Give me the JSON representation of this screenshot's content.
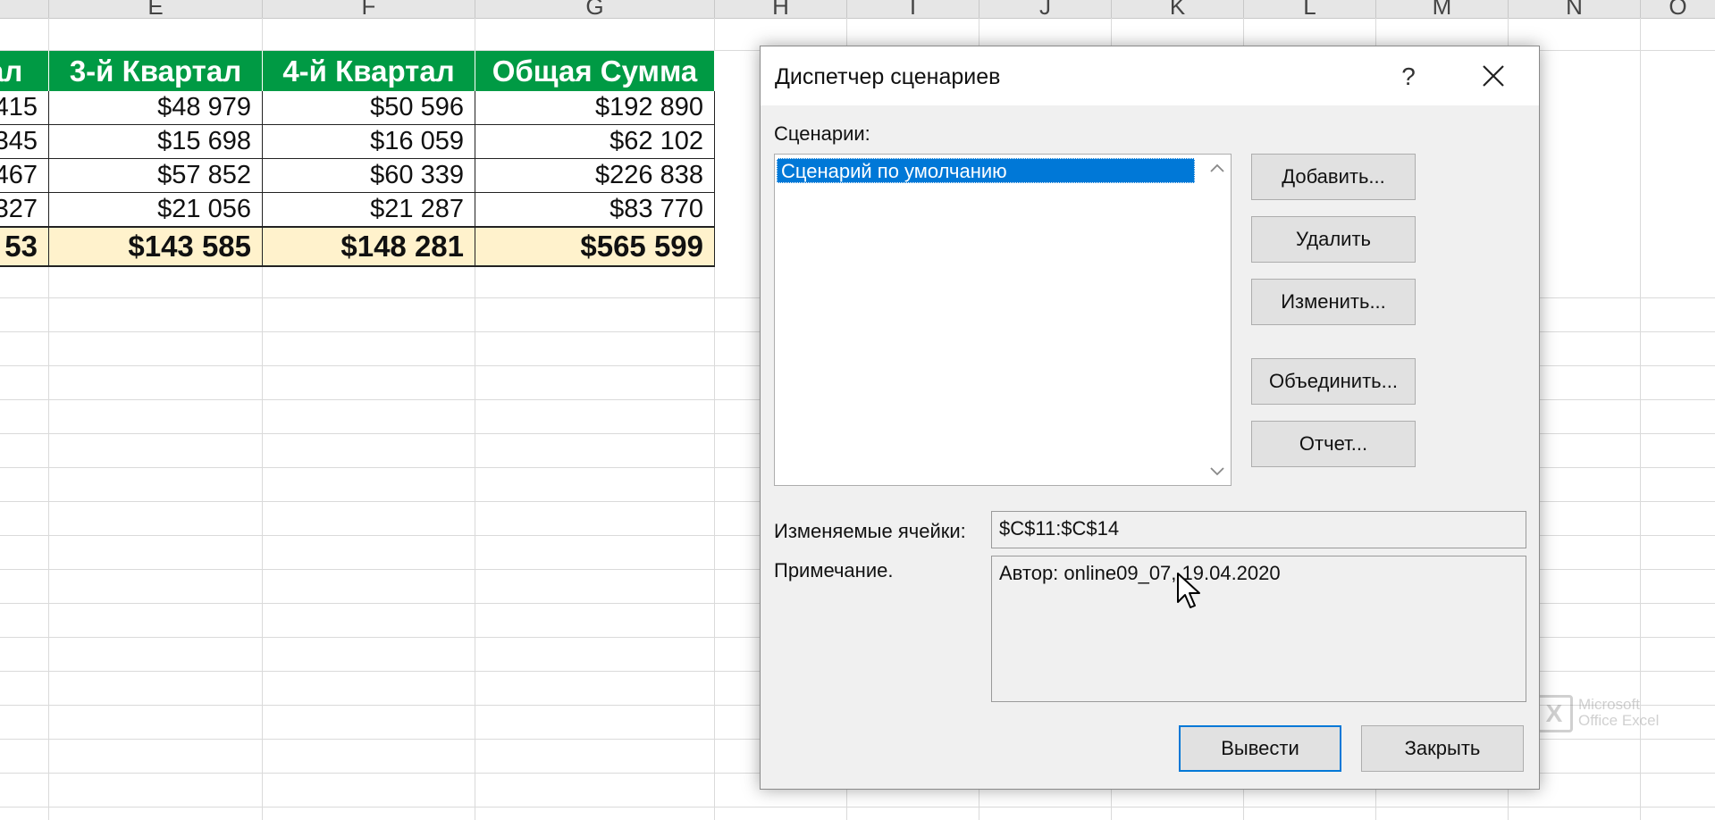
{
  "sheet": {
    "columns": [
      "E",
      "F",
      "G",
      "H",
      "I",
      "J",
      "K",
      "L",
      "M",
      "N",
      "O"
    ],
    "table": {
      "headers": [
        "ал",
        "3-й Квартал",
        "4-й Квартал",
        "Общая Сумма"
      ],
      "rows": [
        [
          "415",
          "$48 979",
          "$50 596",
          "$192 890"
        ],
        [
          "345",
          "$15 698",
          "$16 059",
          "$62 102"
        ],
        [
          "467",
          "$57 852",
          "$60 339",
          "$226 838"
        ],
        [
          "327",
          "$21 056",
          "$21 287",
          "$83 770"
        ]
      ],
      "totals": [
        "53",
        "$143 585",
        "$148 281",
        "$565 599"
      ]
    },
    "colors": {
      "header_bg": "#009a44",
      "total_bg": "#fff2cc"
    },
    "watermark": {
      "brand": "Microsoft Office Excel",
      "line1": "Microsoft",
      "line2": "Office Excel"
    }
  },
  "dialog": {
    "title": "Диспетчер сценариев",
    "help_label": "?",
    "scenarios_label": "Сценарии:",
    "scenarios": [
      "Сценарий по умолчанию"
    ],
    "selected_index": 0,
    "buttons": {
      "add": "Добавить...",
      "delete": "Удалить",
      "edit": "Изменить...",
      "merge": "Объединить...",
      "report": "Отчет...",
      "show": "Вывести",
      "close": "Закрыть"
    },
    "changing_cells_label": "Изменяемые ячейки:",
    "changing_cells_value": "$C$11:$C$14",
    "comment_label": "Примечание.",
    "comment_value": "Автор: online09_07, 19.04.2020"
  },
  "icons": [
    "close-icon",
    "chevron-up-icon",
    "chevron-down-icon",
    "mouse-cursor-icon",
    "excel-logo-icon"
  ]
}
